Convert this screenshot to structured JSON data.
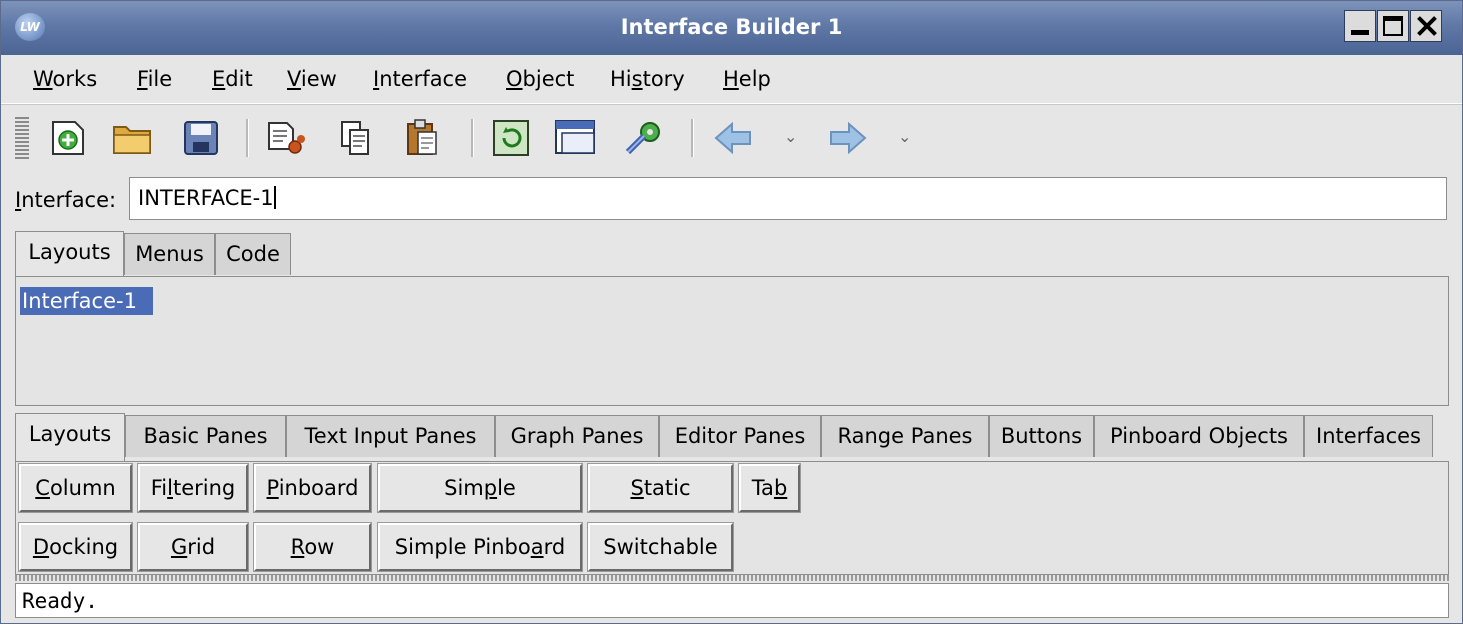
{
  "window": {
    "title": "Interface Builder 1",
    "app_icon": "LW"
  },
  "menu": [
    {
      "pre": "",
      "mn": "W",
      "post": "orks"
    },
    {
      "pre": "",
      "mn": "F",
      "post": "ile"
    },
    {
      "pre": "",
      "mn": "E",
      "post": "dit"
    },
    {
      "pre": "",
      "mn": "V",
      "post": "iew"
    },
    {
      "pre": "",
      "mn": "I",
      "post": "nterface"
    },
    {
      "pre": "",
      "mn": "O",
      "post": "bject"
    },
    {
      "pre": "Hi",
      "mn": "s",
      "post": "tory"
    },
    {
      "pre": "",
      "mn": "H",
      "post": "elp"
    }
  ],
  "toolbar_icons": [
    "new-icon",
    "open-folder-icon",
    "save-icon",
    "cut-icon",
    "copy-icon",
    "paste-icon",
    "refresh-icon",
    "window-icon",
    "settings-gear-icon",
    "back-arrow-icon",
    "forward-arrow-icon"
  ],
  "interface_field": {
    "label_mn": "I",
    "label_rest": "nterface:",
    "value": "INTERFACE-1"
  },
  "top_tabs": [
    "Layouts",
    "Menus",
    "Code"
  ],
  "layouts_list": [
    "Interface-1"
  ],
  "palette_tabs": [
    "Layouts",
    "Basic Panes",
    "Text Input Panes",
    "Graph Panes",
    "Editor Panes",
    "Range Panes",
    "Buttons",
    "Pinboard Objects",
    "Interfaces"
  ],
  "palette_row1": [
    {
      "pre": "",
      "mn": "C",
      "post": "olumn"
    },
    {
      "pre": "Fi",
      "mn": "l",
      "post": "tering"
    },
    {
      "pre": "",
      "mn": "P",
      "post": "inboard"
    },
    {
      "pre": "Sim",
      "mn": "p",
      "post": "le"
    },
    {
      "pre": "",
      "mn": "S",
      "post": "tatic"
    },
    {
      "pre": "Ta",
      "mn": "b",
      "post": ""
    }
  ],
  "palette_row2": [
    {
      "pre": "",
      "mn": "D",
      "post": "ocking"
    },
    {
      "pre": "",
      "mn": "G",
      "post": "rid"
    },
    {
      "pre": "",
      "mn": "R",
      "post": "ow"
    },
    {
      "pre": "Simple Pinbo",
      "mn": "a",
      "post": "rd"
    },
    {
      "pre": "Switchable",
      "mn": "",
      "post": ""
    }
  ],
  "status": "Ready."
}
